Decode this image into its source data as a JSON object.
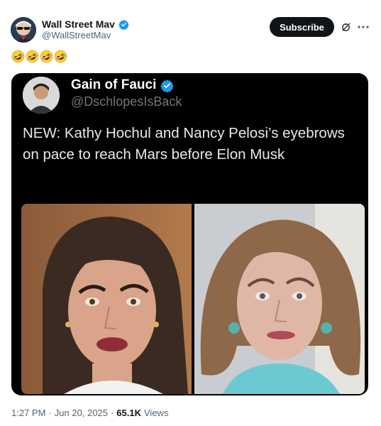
{
  "author": {
    "name": "Wall Street Mav",
    "handle": "@WallStreetMav",
    "verified": true,
    "avatar_icon": "avatar-sunglasses-icon"
  },
  "header": {
    "subscribe_label": "Subscribe",
    "grok_icon": "grok-icon",
    "more_icon": "more-horizontal-icon"
  },
  "post": {
    "emoji_text": "🤣🤣🤣🤣",
    "emoji_icons": [
      "rolling-laughing-emoji",
      "rolling-laughing-emoji",
      "rolling-laughing-emoji",
      "rolling-laughing-emoji"
    ]
  },
  "quoted": {
    "name": "Gain of Fauci",
    "handle": "@DschlopesIsBack",
    "verified": true,
    "text": "NEW: Kathy Hochul and Nancy Pelosi’s eyebrows on pace to reach Mars before Elon Musk",
    "images": [
      "photo-woman-dark-hair",
      "photo-woman-auburn-hair"
    ]
  },
  "meta": {
    "time": "1:27 PM",
    "separator": "·",
    "date": "Jun 20, 2025",
    "views_count": "65.1K",
    "views_label": "Views"
  },
  "colors": {
    "verified_blue": "#1d9bf0",
    "text_primary": "#0f1419",
    "text_secondary": "#536471",
    "card_bg": "#000000"
  }
}
